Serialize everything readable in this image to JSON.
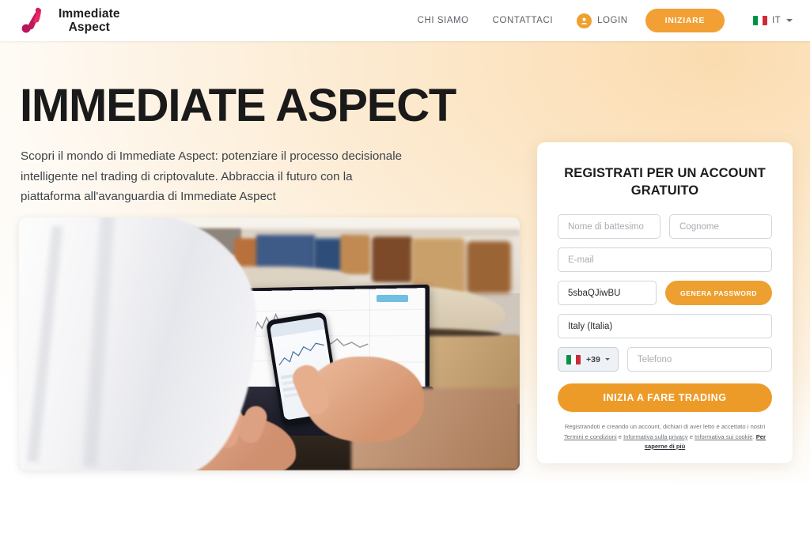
{
  "header": {
    "brand_line1": "Immediate",
    "brand_line2": "Aspect",
    "logo_icon": "immediate-aspect-logo",
    "nav": [
      {
        "label": "CHI SIAMO",
        "name": "nav-chi-siamo"
      },
      {
        "label": "CONTATTACI",
        "name": "nav-contattaci"
      }
    ],
    "login_label": "LOGIN",
    "login_icon": "user-avatar-icon",
    "cta_label": "INIZIARE",
    "language": {
      "code": "IT",
      "flag_icon": "italy-flag-icon",
      "caret_icon": "chevron-down-icon"
    }
  },
  "hero": {
    "title": "IMMEDIATE ASPECT",
    "subtitle": "Scopri il mondo di Immediate Aspect: potenziare il processo decisionale intelligente nel trading di criptovalute. Abbraccia il futuro con la piattaforma all'avanguardia di Immediate Aspect",
    "image_alt": "Persona con smartphone e laptop che mostra un grafico di trading"
  },
  "form": {
    "title": "REGISTRATI PER UN ACCOUNT GRATUITO",
    "first_name_placeholder": "Nome di battesimo",
    "last_name_placeholder": "Cognome",
    "email_placeholder": "E-mail",
    "password_value": "5sbaQJiwBU",
    "generate_password_label": "GENERA PASSWORD",
    "country_value": "Italy (Italia)",
    "phone_prefix": "+39",
    "phone_flag_icon": "italy-flag-icon",
    "phone_caret_icon": "chevron-down-icon",
    "phone_placeholder": "Telefono",
    "submit_label": "INIZIA A FARE TRADING",
    "legal": {
      "line1": "Registrandoti e creando un account, dichiari di aver letto e accettato i",
      "prefix2": "nostri ",
      "link_terms": "Termini e condizioni",
      "sep1": " e ",
      "link_privacy": "Informativa sulla privacy",
      "sep2": " e ",
      "link_cookie": "Informativa sui cookie",
      "period": ". ",
      "link_more": "Per saperne di più"
    }
  },
  "colors": {
    "accent_orange": "#ed9b28",
    "brand_crimson": "#c2185b",
    "bg_peach": "#fbdcb0",
    "text_dark": "#1a1a1a"
  }
}
